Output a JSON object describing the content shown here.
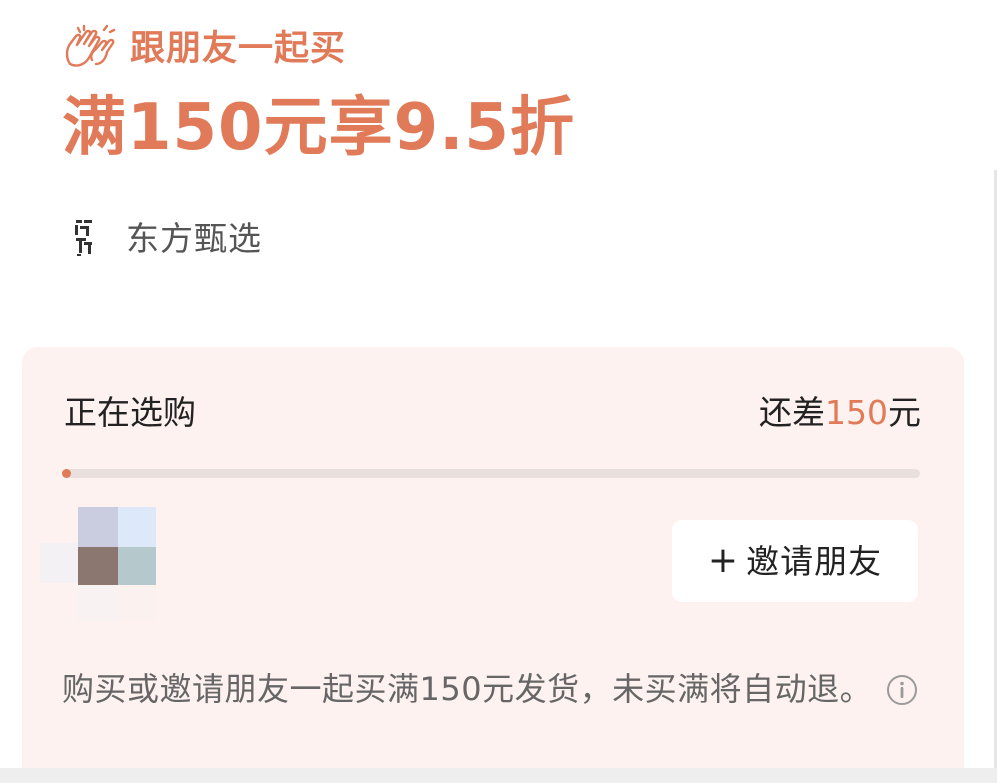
{
  "header": {
    "icon": "waving-hands-icon",
    "title": "跟朋友一起买"
  },
  "offer": {
    "headline": "满150元享9.5折"
  },
  "shop": {
    "logo": "shop-logo",
    "name": "东方甄选"
  },
  "progress": {
    "status": "正在选购",
    "remain_prefix": "还差",
    "remain_amount": "150",
    "remain_suffix": "元",
    "fraction": 0.01
  },
  "invite": {
    "plus": "+",
    "label": "邀请朋友"
  },
  "note": {
    "text": "购买或邀请朋友一起买满150元发货，未买满将自动退。",
    "icon": "info-icon"
  },
  "colors": {
    "accent": "#e07a59",
    "card_bg": "#fdf2ef"
  }
}
